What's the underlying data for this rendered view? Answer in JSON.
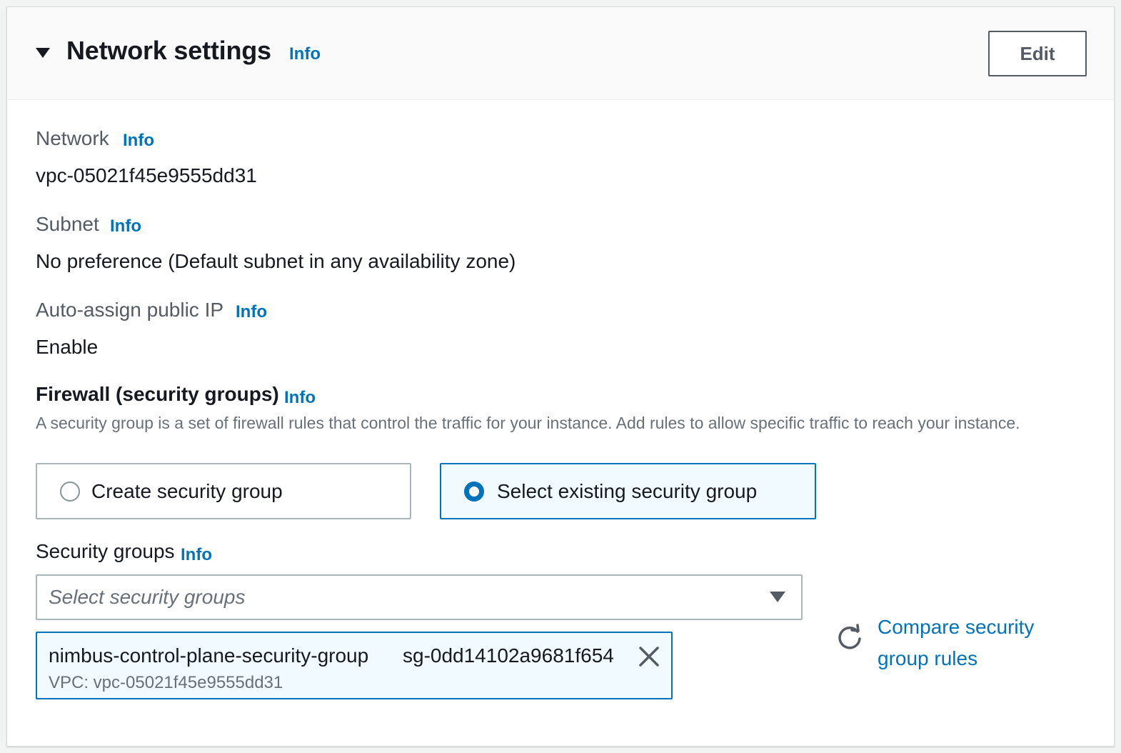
{
  "header": {
    "title": "Network settings",
    "info_label": "Info",
    "edit_label": "Edit"
  },
  "network": {
    "label": "Network",
    "info_label": "Info",
    "value": "vpc-05021f45e9555dd31"
  },
  "subnet": {
    "label": "Subnet",
    "info_label": "Info",
    "value": "No preference (Default subnet in any availability zone)"
  },
  "public_ip": {
    "label": "Auto-assign public IP",
    "info_label": "Info",
    "value": "Enable"
  },
  "firewall": {
    "title": "Firewall (security groups)",
    "info_label": "Info",
    "description": "A security group is a set of firewall rules that control the traffic for your instance. Add rules to allow specific traffic to reach your instance.",
    "options": [
      {
        "label": "Create security group",
        "selected": false
      },
      {
        "label": "Select existing security group",
        "selected": true
      }
    ]
  },
  "security_groups": {
    "label": "Security groups",
    "info_label": "Info",
    "placeholder": "Select security groups",
    "selected": [
      {
        "name": "nimbus-control-plane-security-group",
        "id": "sg-0dd14102a9681f654",
        "vpc": "VPC: vpc-05021f45e9555dd31"
      }
    ],
    "compare_link": "Compare security group rules"
  },
  "colors": {
    "link": "#0073bb",
    "selected_bg": "#f1faff",
    "text": "#16191f",
    "muted": "#687078"
  }
}
